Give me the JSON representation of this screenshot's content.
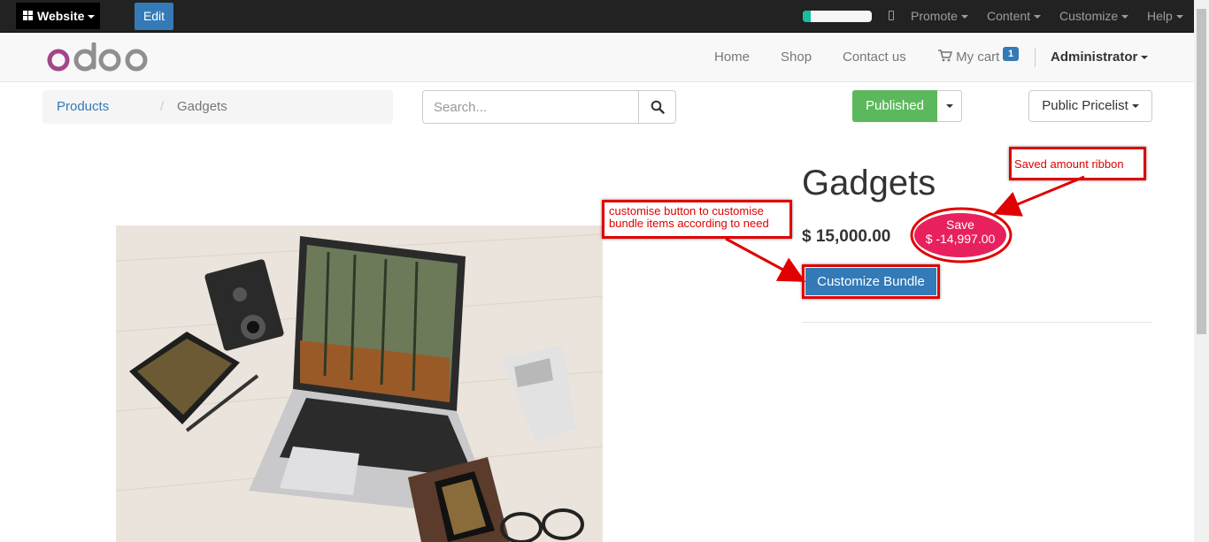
{
  "adminbar": {
    "website_label": "Website",
    "edit_label": "Edit",
    "progress_fraction": 0.12,
    "menu": [
      {
        "label": "Promote"
      },
      {
        "label": "Content"
      },
      {
        "label": "Customize"
      },
      {
        "label": "Help"
      }
    ]
  },
  "header": {
    "logo_text": "odoo",
    "nav": [
      {
        "label": "Home"
      },
      {
        "label": "Shop"
      },
      {
        "label": "Contact us"
      }
    ],
    "cart_label": "My cart",
    "cart_count": "1",
    "user_label": "Administrator"
  },
  "toolbar": {
    "breadcrumb_link": "Products",
    "breadcrumb_separator": "/",
    "breadcrumb_active": "Gadgets",
    "search_placeholder": "Search...",
    "published_label": "Published",
    "pricelist_label": "Public Pricelist"
  },
  "product": {
    "title": "Gadgets",
    "price": "$ 15,000.00",
    "save_label": "Save",
    "save_amount": "$ -14,997.00",
    "customize_label": "Customize Bundle"
  },
  "annotations": {
    "ribbon_note": "Saved amount ribbon",
    "button_note_line1": "customise button to customise",
    "button_note_line2": "bundle items according to need"
  },
  "colors": {
    "accent": "#337ab7",
    "published": "#5cb85c",
    "ribbon": "#e8215e",
    "annotation": "#e00000"
  }
}
